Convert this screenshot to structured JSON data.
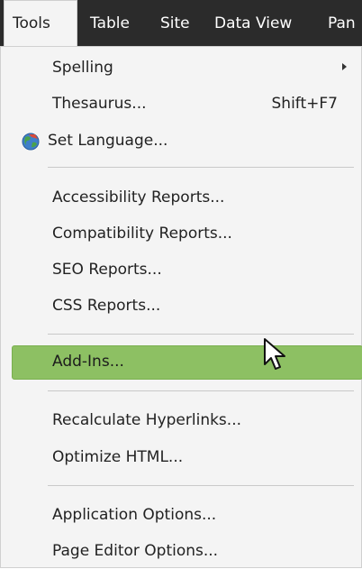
{
  "menubar": {
    "items": [
      "Tools",
      "Table",
      "Site",
      "Data View",
      "Pan"
    ]
  },
  "menu": {
    "spelling": "Spelling",
    "thesaurus": "Thesaurus...",
    "thesaurus_shortcut": "Shift+F7",
    "set_language": "Set Language...",
    "accessibility": "Accessibility Reports...",
    "compatibility": "Compatibility Reports...",
    "seo": "SEO Reports...",
    "css": "CSS Reports...",
    "add_ins": "Add-Ins...",
    "recalc": "Recalculate Hyperlinks...",
    "optimize": "Optimize HTML...",
    "app_options": "Application Options...",
    "page_editor_options": "Page Editor Options..."
  },
  "icons": {
    "set_language": "globe-icon",
    "submenu": "chevron-right-icon",
    "cursor": "mouse-pointer-icon"
  },
  "colors": {
    "menubar_bg": "#2b2b2b",
    "menu_bg": "#f4f4f4",
    "highlight": "#8dc063"
  }
}
